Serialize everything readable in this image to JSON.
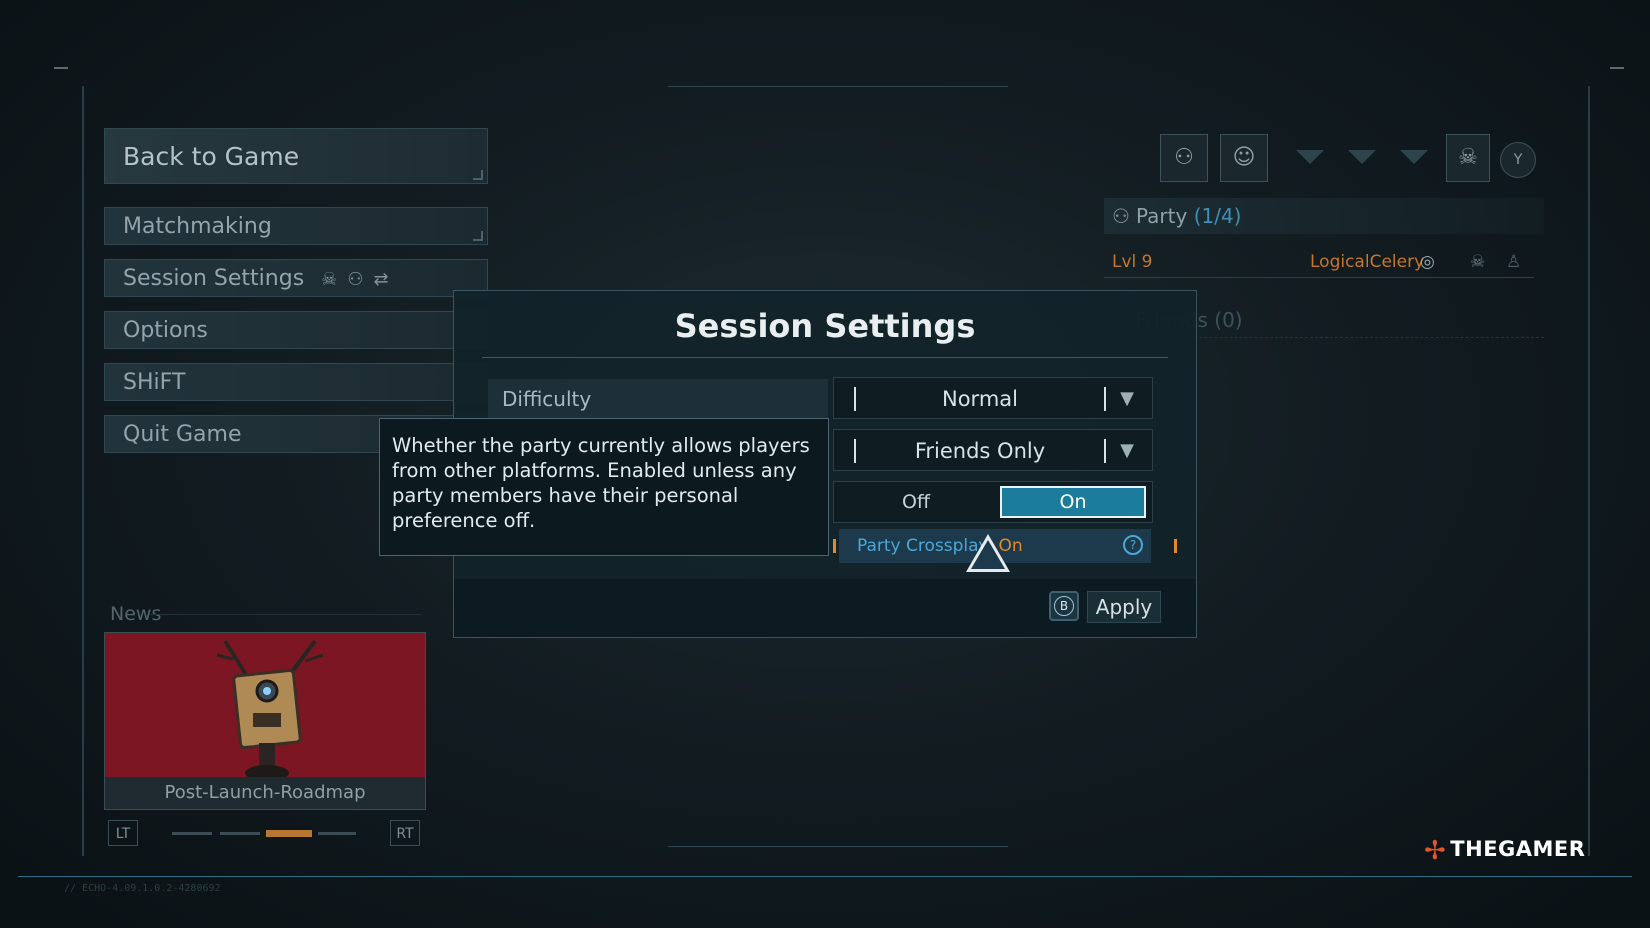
{
  "menu": {
    "back_to_game": "Back to Game",
    "matchmaking": "Matchmaking",
    "session_settings": "Session Settings",
    "options": "Options",
    "shift": "SHiFT",
    "quit_game": "Quit Game"
  },
  "news": {
    "label": "News",
    "caption": "Post-Launch-Roadmap",
    "lt": "LT",
    "rt": "RT"
  },
  "party": {
    "header_label": "Party",
    "header_count": "(1/4)",
    "member_level": "Lvl 9",
    "member_name": "LogicalCelery",
    "friends_label": "Friends (0)",
    "y_button": "Y"
  },
  "modal": {
    "title": "Session Settings",
    "difficulty_label": "Difficulty",
    "difficulty_value": "Normal",
    "privacy_value": "Friends Only",
    "crossplay_off": "Off",
    "crossplay_on": "On",
    "crossplay_row_label": "Party Crossplay:",
    "crossplay_row_value": "On",
    "apply_button_glyph": "B",
    "apply_label": "Apply"
  },
  "tooltip": {
    "text": "Whether the party currently allows players from other platforms. Enabled unless any party members have their personal preference off."
  },
  "watermark": {
    "text": "THEGAMER"
  },
  "version_text": "// ECHO-4.09.1.0.2-4280692",
  "colors": {
    "accent_blue": "#1b7d9b",
    "accent_orange": "#e08a2c",
    "crimson_card": "#7c1622"
  }
}
